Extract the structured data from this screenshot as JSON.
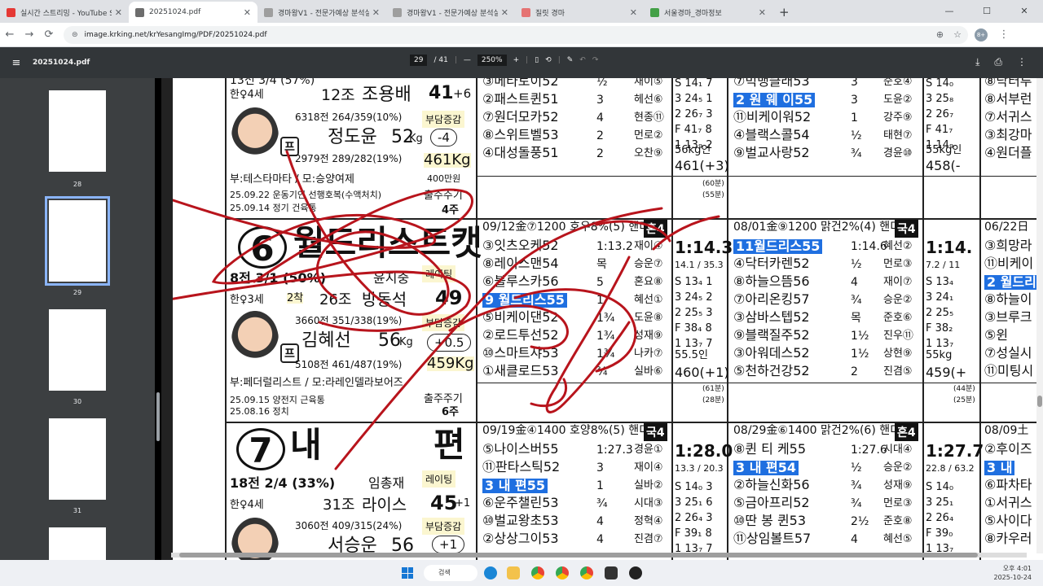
{
  "tabs": [
    {
      "title": "실시간 스트리밍 - YouTube Stu",
      "color": "#e53935"
    },
    {
      "title": "20251024.pdf",
      "color": "#6d6d6d",
      "active": true
    },
    {
      "title": "경마왕V1 - 전문가예상 분석실",
      "color": "#9e9e9e"
    },
    {
      "title": "경마왕V1 - 전문가예상 분석실",
      "color": "#9e9e9e"
    },
    {
      "title": "질릿 경마",
      "color": "#e57373"
    },
    {
      "title": "서울경마_경마정보",
      "color": "#43a047"
    }
  ],
  "address": {
    "url": "image.krking.net/krYesangImg/PDF/20251024.pdf",
    "profile": "8+"
  },
  "pdf": {
    "filename": "20251024.pdf",
    "page": "29",
    "total": "/ 41",
    "zoom": "250%"
  },
  "thumbs": [
    {
      "label": "28"
    },
    {
      "label": "29"
    },
    {
      "label": "30"
    },
    {
      "label": "31"
    }
  ],
  "race": {
    "top_left": {
      "line1": "13전 3/4 (57%)",
      "trainer_group": "12조",
      "trainer": "조용배",
      "rating": "41",
      "rating_delta": "+6",
      "wlabel": "부담증감",
      "jockey_stats": "6318전 264/359(10%)",
      "jockey": "정도윤",
      "weight": "52",
      "unit": "Kg",
      "wdelta": "-4",
      "j2": "2979전 289/282(19%)",
      "horse_w": "461Kg",
      "prize": "400만원",
      "sire": "부:테스타마타 / 모:승양여제",
      "sex_age": "한♀4세",
      "prev1": "25.09.22 운동기인 선행호복(수액처치)",
      "prev2": "25.09.14 정기 건육통",
      "result": "출주주기",
      "rank": "4주"
    },
    "h6": {
      "num": "6",
      "name": "월드리스트캣",
      "line": "8전 3/1 (50%)",
      "owner": "윤지중",
      "rlabel": "레이팅",
      "rating": "49",
      "sex_age": "한♀3세",
      "rank2": "2착",
      "trainer_group": "26조",
      "trainer": "방동석",
      "wlabel": "부담증감",
      "jstats": "3660전 351/338(19%)",
      "jockey": "김혜선",
      "weight": "56",
      "unit": "Kg",
      "wdelta": "+0.5",
      "j2": "5108전 461/487(19%)",
      "horse_w": "459Kg",
      "sire": "부:페더럴리스트 / 모:라레인델라보어즈",
      "prev1": "25.09.15 양전지 근육통",
      "prev2": "25.08.16 정치",
      "result": "출주주기",
      "rank": "6주"
    },
    "h7": {
      "num": "7",
      "name": "내",
      "name2": "편",
      "line": "18전 2/4 (33%)",
      "owner": "임총재",
      "rlabel": "레이팅",
      "rating": "45",
      "rating_delta": "+1",
      "sex_age": "한♀4세",
      "trainer_group": "31조",
      "trainer": "라이스",
      "wlabel": "부담증감",
      "jstats": "3060전 409/315(24%)",
      "jockey": "서승운",
      "weight": "56",
      "unit": "Kg",
      "wdelta": "+1"
    },
    "col1": {
      "top": [
        "③메타토이52",
        "②패스트퀸51",
        "⑦원더모카52",
        "⑧스위트벨53",
        "④대성돌풍51"
      ],
      "top_margin": [
        "½",
        "3",
        "4",
        "2",
        "2"
      ],
      "top_jk": [
        "재이⑤",
        "헤선⑥",
        "현종⑪",
        "먼로②",
        "오찬⑨"
      ],
      "header": "09/12金⑦1200 호우8%(5) 핸디캡",
      "cls": "혼4",
      "rows": [
        "③잇츠오케52",
        "⑧레이스맨54",
        "⑥블루스카56",
        "9 월드리스55",
        "⑤비케이댄52",
        "②로드투선52",
        "⑩스마트샤53",
        "①새클로드53"
      ],
      "margin": [
        "1:13.2",
        "목",
        "5",
        "1",
        "1¾",
        "1¾",
        "1¾",
        "¾"
      ],
      "jk": [
        "재이④",
        "승운⑦",
        "혼요⑧",
        "혜선①",
        "도윤⑧",
        "성재⑨",
        "나카⑦",
        "실바⑥"
      ],
      "header2": "09/19金④1400 호양8%(5) 핸디캡",
      "cls2": "국4",
      "rows2": [
        "⑤나이스버55",
        "⑪판타스틱52",
        "3 내 편55",
        "⑥운주챌린53",
        "⑩벌교왕초53",
        "②상상그이53"
      ],
      "margin2": [
        "1:27.3",
        "3",
        "1",
        "¾",
        "4",
        "4"
      ],
      "jk2": [
        "경윤①",
        "재이④",
        "실바②",
        "시대③",
        "정혁④",
        "진겸⑦"
      ]
    },
    "col1b": {
      "time": "1:14.3",
      "sub": "14.1 / 35.3",
      "s": "S 13₄ 1",
      "vals": [
        "3 24₅ 2",
        "2 25₅ 3",
        "F 38₄ 8",
        "1 13₇ 7"
      ],
      "wt": "55.5인",
      "bot": "460(+1)",
      "time2": "1:28.0",
      "sub2": "13.3 / 20.3",
      "s2": "S 14₀ 3",
      "vals2": [
        "3 25₁ 6",
        "2 26₄ 3",
        "F 39₁ 8",
        "1 13₇ 7"
      ],
      "top_vals": [
        "S 14₁ 7",
        "3 24₅ 1",
        "2 26₇ 3",
        "F 41₇ 8",
        "1 13₉ 2"
      ],
      "top_w": "56kg인",
      "top_b": "461(+3)"
    },
    "col2": {
      "top": [
        "⑦빅뱅클래53",
        "2 원 웨 이55",
        "⑪비케이워52",
        "④블랙스콜54",
        "⑨벌교사랑52"
      ],
      "top_margin": [
        "3",
        "3",
        "1",
        "½",
        "¾"
      ],
      "top_jk": [
        "준호④",
        "도윤②",
        "강주⑨",
        "태현⑦",
        "경윤⑩"
      ],
      "header": "08/01金⑨1200 맑건2%(4) 핸디캡",
      "cls": "국4",
      "rows": [
        "11월드리스55",
        "④닥터카렌52",
        "⑧하늘으뜸56",
        "⑦아리온킹57",
        "③삼바스텝52",
        "⑨블랙질주52",
        "③아워데스52",
        "⑤천하건강52"
      ],
      "margin": [
        "1:14.6",
        "½",
        "4",
        "¾",
        "목",
        "1½",
        "1½",
        "2"
      ],
      "jk": [
        "혜선②",
        "먼로③",
        "재이⑦",
        "승운②",
        "준호⑥",
        "진우⑪",
        "상현⑨",
        "진겸⑤"
      ],
      "header2": "08/29金⑥1400 맑건2%(6) 핸디캡",
      "cls2": "혼4",
      "rows2": [
        "⑧퀸 티 케55",
        "3 내 편54",
        "②하늘신화56",
        "⑤금아프리52",
        "⑩딴 봉 퀸53",
        "⑪상임볼트57"
      ],
      "margin2": [
        "1:27.6",
        "½",
        "¾",
        "¾",
        "2½",
        "4"
      ],
      "jk2": [
        "시대④",
        "승운②",
        "성재⑨",
        "먼로③",
        "준호⑧",
        "혜선⑤"
      ]
    },
    "col2b": {
      "time": "1:14.",
      "sub": "7.2 / 11",
      "vals": [
        "S 13₄",
        "3 24₁",
        "2 25₅",
        "F 38₂",
        "1 13₇"
      ],
      "wt": "55kg",
      "bot": "459(+",
      "time2": "1:27.7",
      "sub2": "22.8 / 63.2",
      "vals2": [
        "S 14₀",
        "3 25₁",
        "2 26₄",
        "F 39₀",
        "1 13₇"
      ],
      "top_vals": [
        "S 14₀",
        "3 25₈",
        "2 26₇",
        "F 41₇",
        "1 14₉"
      ],
      "top_w": "55kg인",
      "top_b": "458(-"
    },
    "col3": {
      "top": [
        "⑧닥터루",
        "⑧서부런",
        "⑦서귀스",
        "③최강마",
        "④원더플"
      ],
      "header": "06/22日",
      "rows": [
        "③희망라",
        "⑪비케이",
        "2 월드리",
        "⑧하늘이",
        "③브루크",
        "⑤윈",
        "⑦성실시",
        "⑪미팅시"
      ],
      "header2": "08/09土",
      "rows2": [
        "②후이즈",
        "3 내",
        "⑥파차타",
        "①서귀스",
        "⑤사이다",
        "⑧카우러"
      ]
    },
    "scores": {
      "a": "(60분)",
      "b": "(55분)",
      "c": "(61분)",
      "d": "(28분)",
      "e": "(44분)",
      "f": "(25분)"
    }
  },
  "taskbar": {
    "search": "검색",
    "time": "오후 4:01",
    "date": "2025-10-24"
  },
  "colors": {
    "accent": "#1f6fe0",
    "ink": "#b8141c"
  }
}
